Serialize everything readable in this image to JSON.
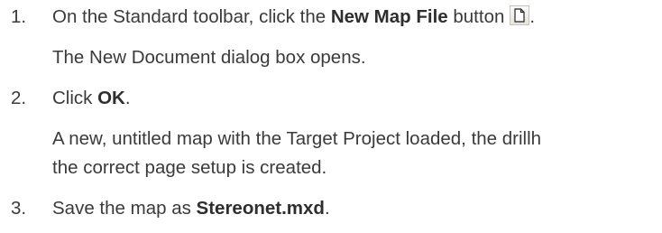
{
  "steps": [
    {
      "number": "1.",
      "pre": "On the Standard toolbar, click the ",
      "bold": "New Map File",
      "post": " button",
      "post2": ".",
      "icon": "new-file-icon",
      "note": "The New Document dialog box opens."
    },
    {
      "number": "2.",
      "pre": "Click ",
      "bold": "OK",
      "post": ".",
      "note_line1": "A new, untitled map with the Target Project loaded, the drillh",
      "note_line2": "the correct page setup is created."
    },
    {
      "number": "3.",
      "pre": "Save the map as ",
      "bold": "Stereonet.mxd",
      "post": "."
    }
  ]
}
